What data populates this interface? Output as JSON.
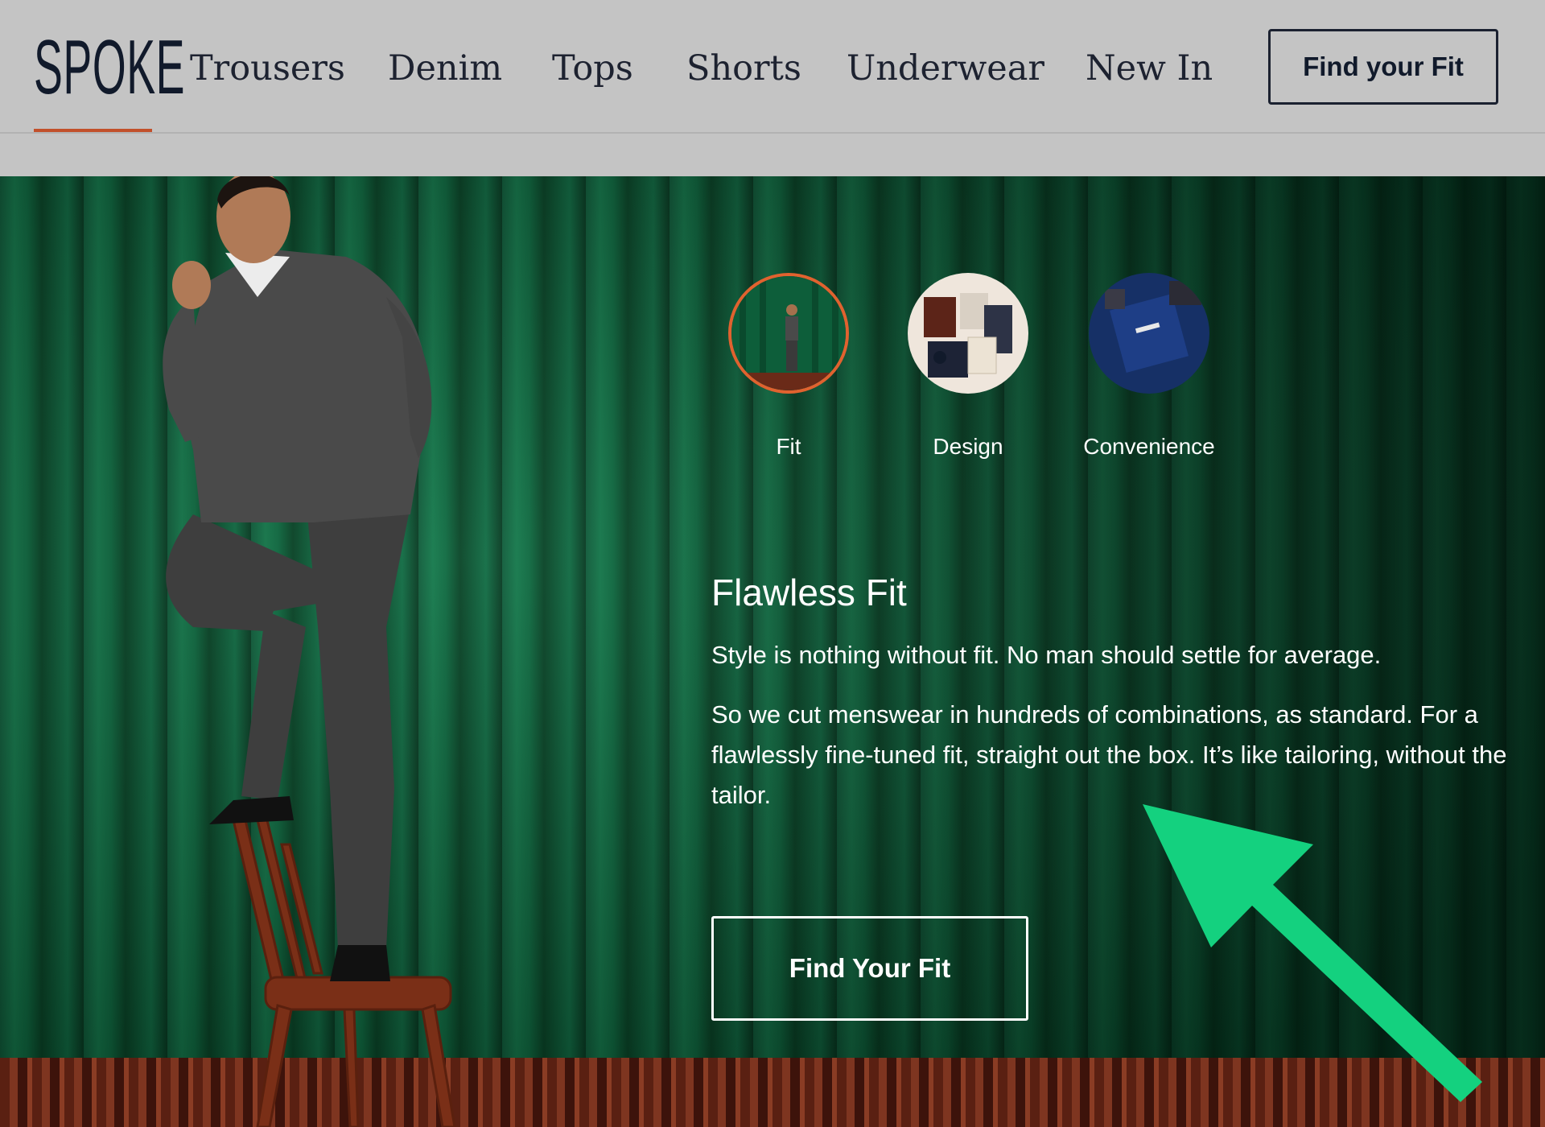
{
  "header": {
    "logo_text": "SPOKE",
    "nav": [
      {
        "label": "Trousers"
      },
      {
        "label": "Denim"
      },
      {
        "label": "Tops"
      },
      {
        "label": "Shorts"
      },
      {
        "label": "Underwear"
      },
      {
        "label": "New In"
      }
    ],
    "cta_label": "Find your Fit"
  },
  "hero": {
    "features": [
      {
        "label": "Fit",
        "active": true,
        "icon": "model-thumbnail"
      },
      {
        "label": "Design",
        "active": false,
        "icon": "clothing-flatlay-thumbnail"
      },
      {
        "label": "Convenience",
        "active": false,
        "icon": "spoke-box-thumbnail"
      }
    ],
    "title": "Flawless Fit",
    "paragraph_1": "Style is nothing without fit. No man should settle for average.",
    "paragraph_2": "So we cut menswear in hundreds of combinations, as standard. For a flawlessly fine-tuned fit, straight out the box. It’s like tailoring, without the tailor.",
    "cta_label": "Find Your Fit"
  },
  "colors": {
    "accent": "#e0622f",
    "logo_underline": "#c2502b",
    "header_bg": "#c4c4c4",
    "curtain": "#0e5c3a",
    "annotation_arrow": "#14d17f"
  }
}
